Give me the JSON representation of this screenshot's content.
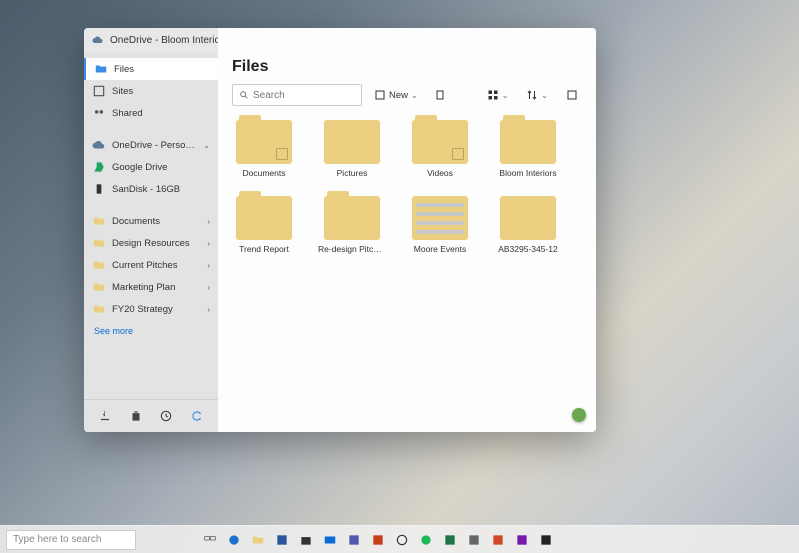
{
  "window": {
    "title": "OneDrive - Bloom Interiors",
    "controls": {
      "min": "−",
      "max": "□",
      "close": "✕"
    }
  },
  "sidebar": {
    "top": [
      {
        "label": "Files",
        "icon": "folder"
      },
      {
        "label": "Sites",
        "icon": "site"
      },
      {
        "label": "Shared",
        "icon": "shared"
      }
    ],
    "drives": [
      {
        "label": "OneDrive - Personal",
        "icon": "cloud",
        "expand": true
      },
      {
        "label": "Google Drive",
        "icon": "gdrive"
      },
      {
        "label": "SanDisk - 16GB",
        "icon": "usb"
      }
    ],
    "folders": [
      {
        "label": "Documents"
      },
      {
        "label": "Design Resources"
      },
      {
        "label": "Current Pitches"
      },
      {
        "label": "Marketing Plan"
      },
      {
        "label": "FY20 Strategy"
      }
    ],
    "see_more": "See more",
    "bottom_icons": [
      "download",
      "trash",
      "history",
      "sync"
    ]
  },
  "main": {
    "title": "Files",
    "search": {
      "placeholder": "Search"
    },
    "toolbar": {
      "new": "New",
      "sort": "sort",
      "view": "view"
    },
    "items": [
      {
        "name": "Documents",
        "type": "folder"
      },
      {
        "name": "Pictures",
        "type": "pictures"
      },
      {
        "name": "Videos",
        "type": "folder"
      },
      {
        "name": "Bloom Interiors",
        "type": "folder"
      },
      {
        "name": "Trend Report",
        "type": "folder"
      },
      {
        "name": "Re-design Pitches",
        "type": "folder"
      },
      {
        "name": "Moore Events",
        "type": "list"
      },
      {
        "name": "AB3295-345-12",
        "type": "image"
      }
    ]
  },
  "taskbar": {
    "search_placeholder": "Type here to search"
  }
}
